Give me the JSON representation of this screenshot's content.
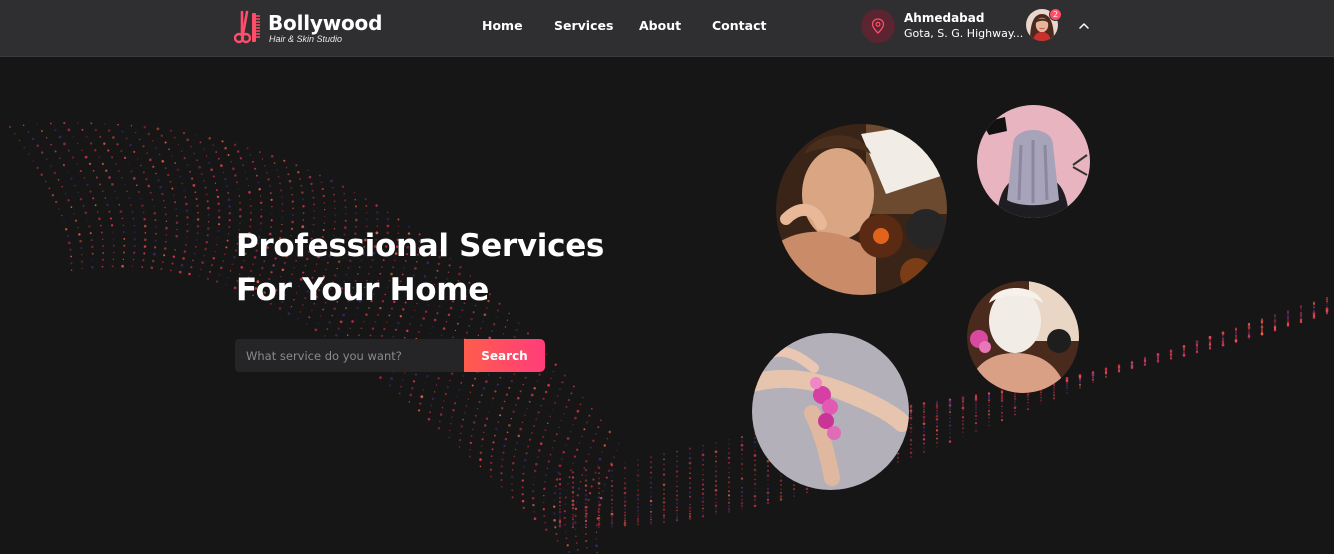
{
  "brand": {
    "name": "Bollywood",
    "tagline": "Hair & Skin Studio",
    "accent": "#ff4d6a"
  },
  "nav": {
    "items": [
      {
        "label": "Home"
      },
      {
        "label": "Services"
      },
      {
        "label": "About"
      },
      {
        "label": "Contact"
      }
    ]
  },
  "location": {
    "city": "Ahmedabad",
    "address": "Gota, S. G. Highway..."
  },
  "user": {
    "notification_count": "2"
  },
  "hero": {
    "title_line1": "Professional Services",
    "title_line2": "For Your Home",
    "search_placeholder": "What service do you want?",
    "search_button": "Search"
  },
  "colors": {
    "background": "#161617",
    "header": "#2f2f31",
    "button_start": "#ff5c4d",
    "button_end": "#ff3d7a"
  }
}
